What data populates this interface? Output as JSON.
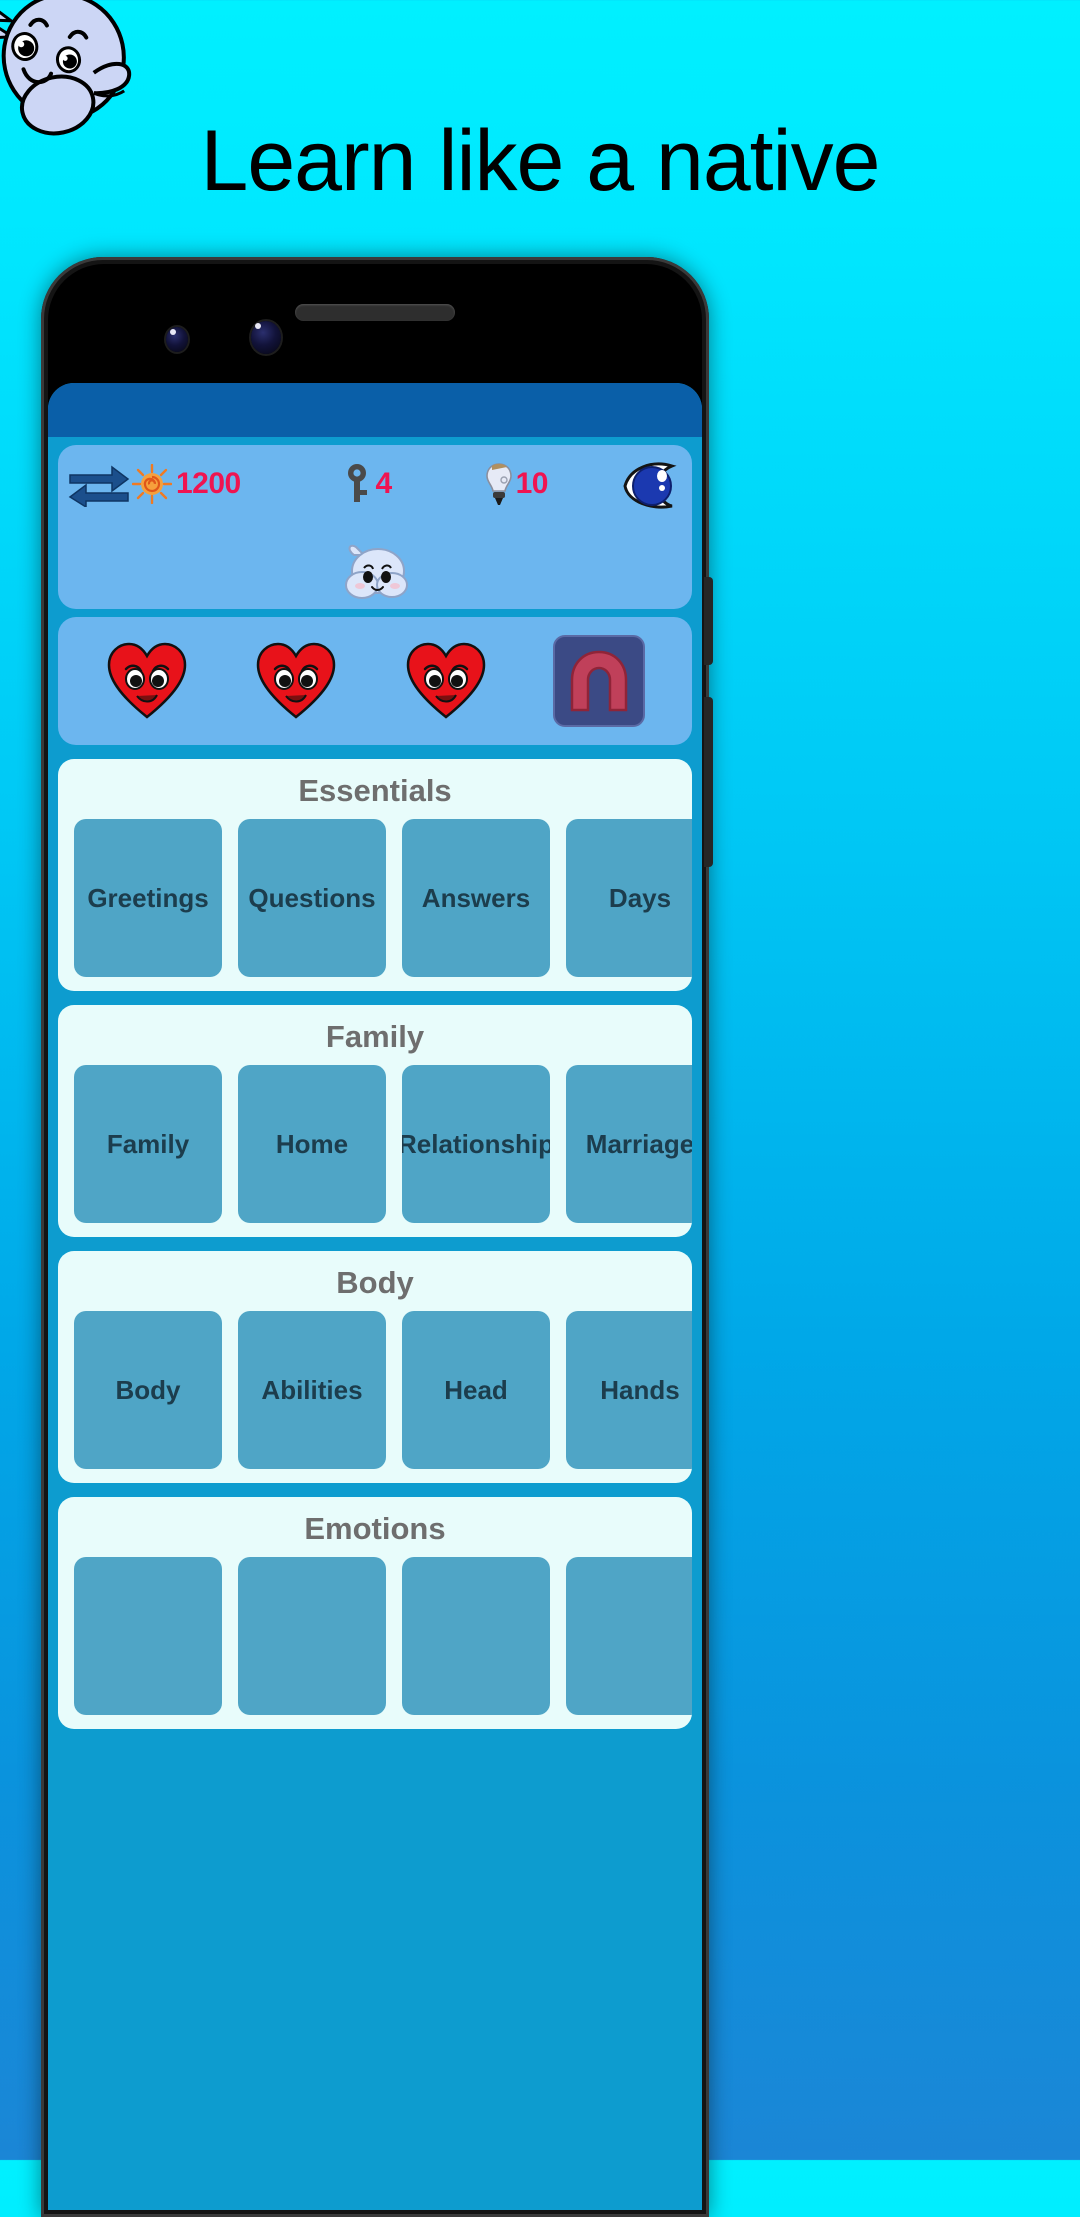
{
  "promo": {
    "headline": "Learn like a native",
    "mascot_icon": "mascot-waving-icon"
  },
  "phone": {
    "speaker_icon": "speaker-grille",
    "camera_icon": "camera-lens"
  },
  "app": {
    "stats": {
      "swap_icon": "swap-arrows-icon",
      "sun_icon": "sun-icon",
      "sun_value": "1200",
      "key_icon": "key-icon",
      "key_value": "4",
      "bulb_icon": "lightbulb-icon",
      "bulb_value": "10",
      "eye_icon": "eye-icon",
      "mascot_icon": "mascot-face-icon"
    },
    "lives": {
      "heart_icon": "heart-face-icon",
      "hearts_count": 3,
      "magnet_icon": "magnet-icon"
    },
    "categories": [
      {
        "title": "Essentials",
        "tiles": [
          "Greetings",
          "Questions",
          "Answers",
          "Days"
        ]
      },
      {
        "title": "Family",
        "tiles": [
          "Family",
          "Home",
          "Relationship",
          "Marriage"
        ]
      },
      {
        "title": "Body",
        "tiles": [
          "Body",
          "Abilities",
          "Head",
          "Hands"
        ]
      },
      {
        "title": "Emotions",
        "tiles": [
          "",
          "",
          "",
          ""
        ]
      }
    ]
  },
  "colors": {
    "background_top": "#00f0ff",
    "background_bottom": "#1b86d6",
    "app_background": "#0d9ccf",
    "statusbar": "#0a5fa8",
    "panel": "#6cb6ef",
    "card": "#e8fcfb",
    "tile": "#4fa5c6",
    "accent_value": "#ef1451",
    "heart": "#e8121a",
    "title_text": "#6e6e6e",
    "tile_text": "#1c3d4d"
  }
}
